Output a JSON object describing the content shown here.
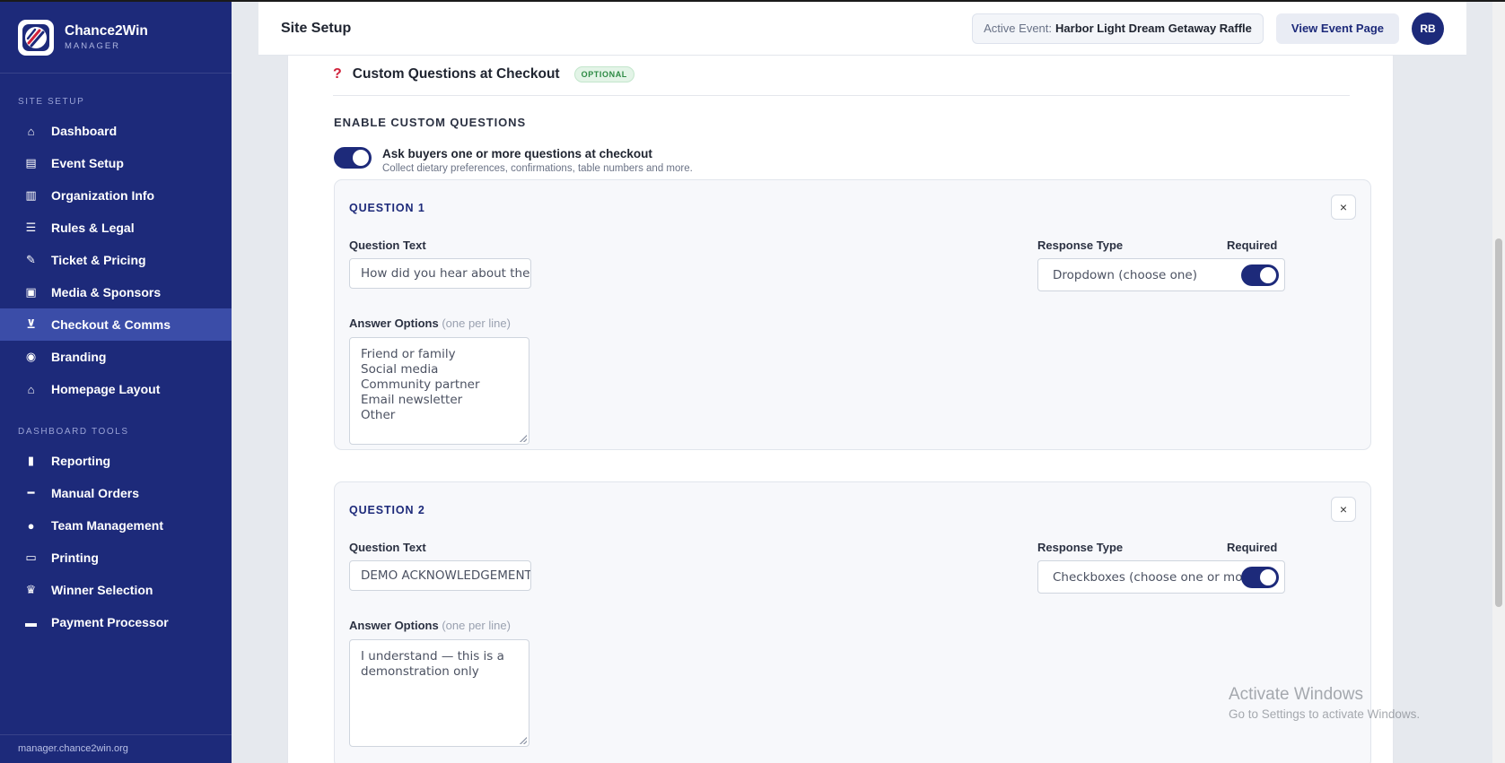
{
  "brand": {
    "name": "Chance2Win",
    "subtitle": "MANAGER"
  },
  "sidebar": {
    "section1": "SITE SETUP",
    "items1": [
      {
        "label": "Dashboard",
        "icon": "home-icon"
      },
      {
        "label": "Event Setup",
        "icon": "clipboard-icon"
      },
      {
        "label": "Organization Info",
        "icon": "building-icon"
      },
      {
        "label": "Rules & Legal",
        "icon": "scroll-icon"
      },
      {
        "label": "Ticket & Pricing",
        "icon": "ticket-icon"
      },
      {
        "label": "Media & Sponsors",
        "icon": "image-icon"
      },
      {
        "label": "Checkout & Comms",
        "icon": "cart-icon",
        "active": true
      },
      {
        "label": "Branding",
        "icon": "palette-icon"
      },
      {
        "label": "Homepage Layout",
        "icon": "home-layout-icon"
      }
    ],
    "section2": "DASHBOARD TOOLS",
    "items2": [
      {
        "label": "Reporting",
        "icon": "bar-chart-icon"
      },
      {
        "label": "Manual Orders",
        "icon": "pen-icon"
      },
      {
        "label": "Team Management",
        "icon": "user-icon"
      },
      {
        "label": "Printing",
        "icon": "printer-icon"
      },
      {
        "label": "Winner Selection",
        "icon": "trophy-icon"
      },
      {
        "label": "Payment Processor",
        "icon": "credit-card-icon"
      }
    ],
    "footer": "manager.chance2win.org"
  },
  "header": {
    "title": "Site Setup",
    "event_label": "Active Event:",
    "event_name": "Harbor Light Dream Getaway Raffle",
    "view_button": "View Event Page",
    "avatar": "RB"
  },
  "section": {
    "icon": "?",
    "title": "Custom Questions at Checkout",
    "badge": "OPTIONAL",
    "enable_label": "ENABLE CUSTOM QUESTIONS",
    "toggle_title": "Ask buyers one or more questions at checkout",
    "toggle_sub": "Collect dietary preferences, confirmations, table numbers and more."
  },
  "labels": {
    "question_text": "Question Text",
    "response_type": "Response Type",
    "required": "Required",
    "answer_options": "Answer Options",
    "answer_hint": "(one per line)",
    "close": "×"
  },
  "questions": [
    {
      "title": "QUESTION 1",
      "text_value": "How did you hear about the H",
      "response_type": "Dropdown (choose one)",
      "required": true,
      "options": [
        "Friend or family",
        "Social media",
        "Community partner",
        "Email newsletter",
        "Other"
      ]
    },
    {
      "title": "QUESTION 2",
      "text_value": "DEMO ACKNOWLEDGEMENT",
      "response_type": "Checkboxes (choose one or mo",
      "required": true,
      "options": [
        "I understand — this is a",
        "demonstration only"
      ]
    }
  ],
  "watermark": {
    "line1": "Activate Windows",
    "line2": "Go to Settings to activate Windows."
  },
  "colors": {
    "primary": "#1d2a7a",
    "active_nav": "#3b4da8",
    "accent_red": "#d0213a",
    "badge_green": "#2d8a44"
  }
}
